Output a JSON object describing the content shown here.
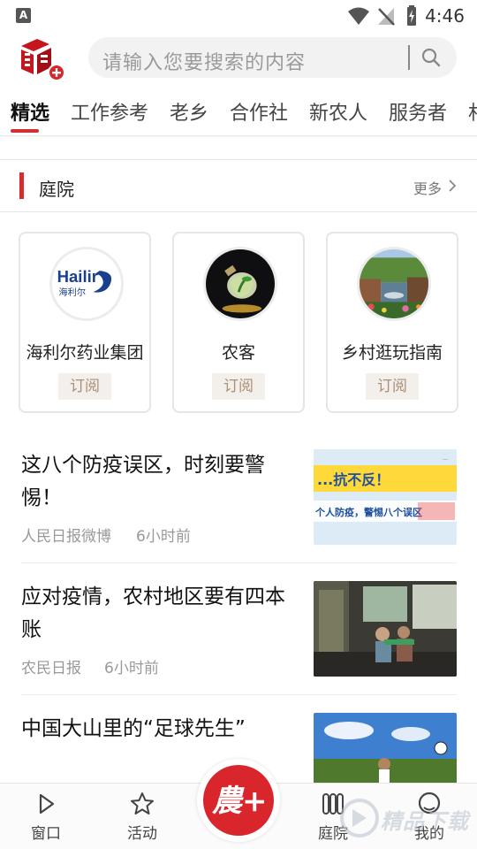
{
  "status_bar": {
    "time": "4:46",
    "icons": [
      "notification-a-icon",
      "wifi-icon",
      "no-signal-icon",
      "battery-charging-icon"
    ]
  },
  "header": {
    "search_placeholder": "请输入您要搜索的内容",
    "brand_color": "#d32f2f"
  },
  "tabs": [
    {
      "label": "精选",
      "active": true
    },
    {
      "label": "工作参考",
      "active": false
    },
    {
      "label": "老乡",
      "active": false
    },
    {
      "label": "合作社",
      "active": false
    },
    {
      "label": "新农人",
      "active": false
    },
    {
      "label": "服务者",
      "active": false
    },
    {
      "label": "村",
      "active": false
    }
  ],
  "courtyard": {
    "title": "庭院",
    "more": "更多",
    "cards": [
      {
        "name": "海利尔药业集团",
        "subscribe": "订阅",
        "avatar": "hailir-logo",
        "logo_text": "Hailir",
        "logo_subtext": "海利尔"
      },
      {
        "name": "农客",
        "subscribe": "订阅",
        "avatar": "lightbulb-plant-photo"
      },
      {
        "name": "乡村逛玩指南",
        "subscribe": "订阅",
        "avatar": "canal-town-photo"
      }
    ]
  },
  "articles": [
    {
      "title": "这八个防疫误区，时刻要警惕！",
      "source": "人民日报微博",
      "time": "6小时前",
      "thumbnail": "epidemic-banner",
      "thumb_text_1": "...抗不反！",
      "thumb_text_2": "个人防疫，警惕八个误区"
    },
    {
      "title": "应对疫情，农村地区要有四本账",
      "source": "农民日报",
      "time": "6小时前",
      "thumbnail": "classroom-photo"
    },
    {
      "title": "中国大山里的“足球先生”",
      "source": "",
      "time": "",
      "thumbnail": "football-photo"
    }
  ],
  "bottom_nav": {
    "items": [
      {
        "label": "窗口",
        "icon": "play-icon"
      },
      {
        "label": "活动",
        "icon": "star-icon"
      },
      {
        "label": "庭院",
        "icon": "courtyard-icon"
      },
      {
        "label": "我的",
        "icon": "profile-icon"
      }
    ],
    "center": {
      "icon": "nong-plus-icon",
      "text": "農+"
    }
  },
  "watermark": {
    "text": "精品下载"
  }
}
